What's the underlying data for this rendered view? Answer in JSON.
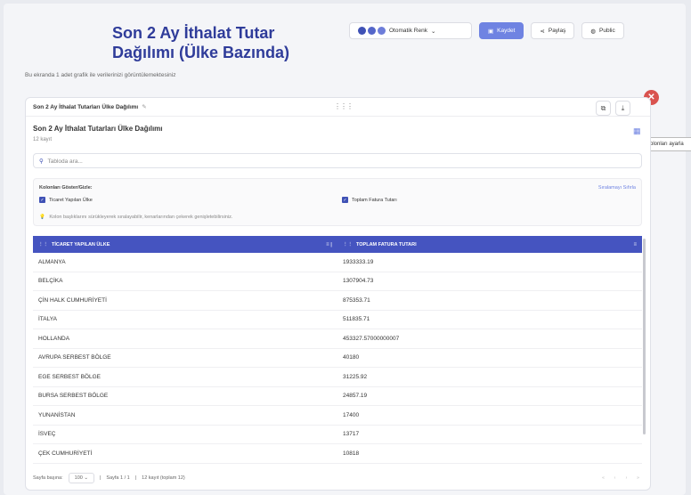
{
  "page": {
    "title": "Son 2 Ay İthalat Tutar Dağılımı (Ülke Bazında)",
    "subtitle": "Bu ekranda 1 adet grafik ile verilerinizi görüntülemektesiniz"
  },
  "toolbar": {
    "theme_label": "Otomatik Renk",
    "save_label": "Kaydet",
    "share_label": "Paylaş",
    "public_label": "Public"
  },
  "card": {
    "header_title": "Son 2 Ay İthalat Tutarları Ülke Dağılımı",
    "table_title": "Son 2 Ay İthalat Tutarları Ülke Dağılımı",
    "record_count": "12 kayıt",
    "tooltip": "Kolonları ayarla",
    "search_placeholder": "Tabloda ara...",
    "columns_label": "Kolonları Göster/Gizle:",
    "reset_label": "Sıralamayı Sıfırla",
    "col1_check": "Ticaret Yapılan Ülke",
    "col2_check": "Toplam Fatura Tutarı",
    "hint": "Kolon başlıklarını sürükleyerek sıralayabilir, kenarlarından çekerek genişletebilirsiniz."
  },
  "table": {
    "headers": [
      "TİCARET YAPILAN ÜLKE",
      "TOPLAM FATURA TUTARI"
    ],
    "rows": [
      [
        "ALMANYA",
        "1933333.19"
      ],
      [
        "BELÇİKA",
        "1307904.73"
      ],
      [
        "ÇİN HALK CUMHURİYETİ",
        "875353.71"
      ],
      [
        "İTALYA",
        "511835.71"
      ],
      [
        "HOLLANDA",
        "453327.57000000007"
      ],
      [
        "AVRUPA SERBEST BÖLGE",
        "40180"
      ],
      [
        "EGE SERBEST BÖLGE",
        "31225.92"
      ],
      [
        "BURSA SERBEST BÖLGE",
        "24857.19"
      ],
      [
        "YUNANİSTAN",
        "17400"
      ],
      [
        "İSVEÇ",
        "13717"
      ],
      [
        "ÇEK CUMHURİYETİ",
        "10818"
      ]
    ]
  },
  "footer": {
    "page_size_label": "Sayfa başına:",
    "page_size_value": "100",
    "page_info": "Sayfa 1 / 1",
    "record_info": "12 kayıt (toplam 12)"
  }
}
